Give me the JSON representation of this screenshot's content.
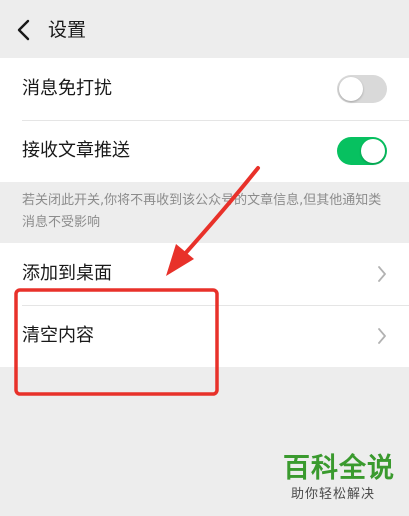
{
  "header": {
    "title": "设置",
    "back_icon": "chevron-left-icon"
  },
  "settings": {
    "do_not_disturb": {
      "label": "消息免打扰",
      "enabled": false
    },
    "receive_push": {
      "label": "接收文章推送",
      "enabled": true
    },
    "hint": "若关闭此开关,你将不再收到该公众号的文章信息,但其他通知类消息不受影响"
  },
  "actions": {
    "add_to_desktop": {
      "label": "添加到桌面",
      "icon": "chevron-right-icon"
    },
    "clear_content": {
      "label": "清空内容",
      "icon": "chevron-right-icon"
    }
  },
  "watermark": {
    "title": "百科全说",
    "subtitle": "助你轻松解决"
  },
  "colors": {
    "background": "#ededed",
    "toggle_on": "#07c160",
    "toggle_off": "#d9d9d9",
    "annotation": "#e8312a",
    "watermark_green": "#3a9a2e"
  }
}
